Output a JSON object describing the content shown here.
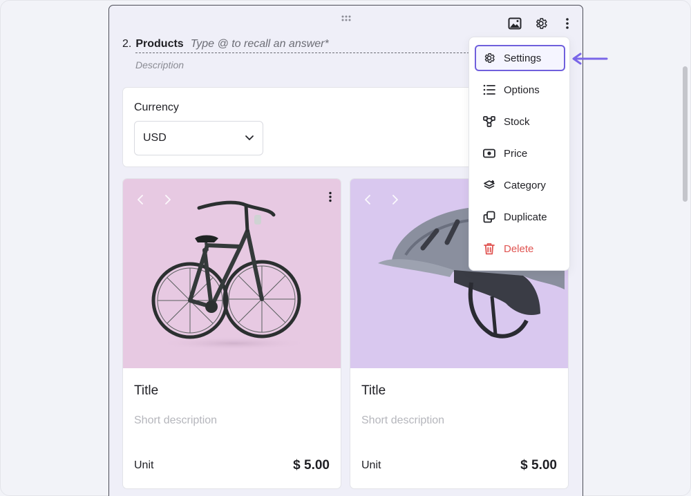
{
  "question": {
    "number": "2.",
    "title": "Products",
    "placeholder": "Type @ to recall an answer*",
    "description": "Description"
  },
  "currency": {
    "label": "Currency",
    "selected": "USD"
  },
  "products": [
    {
      "title": "Title",
      "description": "Short description",
      "unit": "Unit",
      "price": "$ 5.00",
      "image": "bicycle"
    },
    {
      "title": "Title",
      "description": "Short description",
      "unit": "Unit",
      "price": "$ 5.00",
      "image": "helmet"
    }
  ],
  "menu": {
    "items": [
      {
        "label": "Settings",
        "icon": "gear-icon"
      },
      {
        "label": "Options",
        "icon": "list-icon"
      },
      {
        "label": "Stock",
        "icon": "nodes-icon"
      },
      {
        "label": "Price",
        "icon": "cash-icon"
      },
      {
        "label": "Category",
        "icon": "layers-icon"
      },
      {
        "label": "Duplicate",
        "icon": "copy-icon"
      },
      {
        "label": "Delete",
        "icon": "trash-icon"
      }
    ]
  },
  "colors": {
    "accent": "#6f5fdc",
    "danger": "#e05451",
    "card_bg": "#efeff8",
    "product1_bg": "#e7c9e2",
    "product2_bg": "#d9c8ef"
  }
}
